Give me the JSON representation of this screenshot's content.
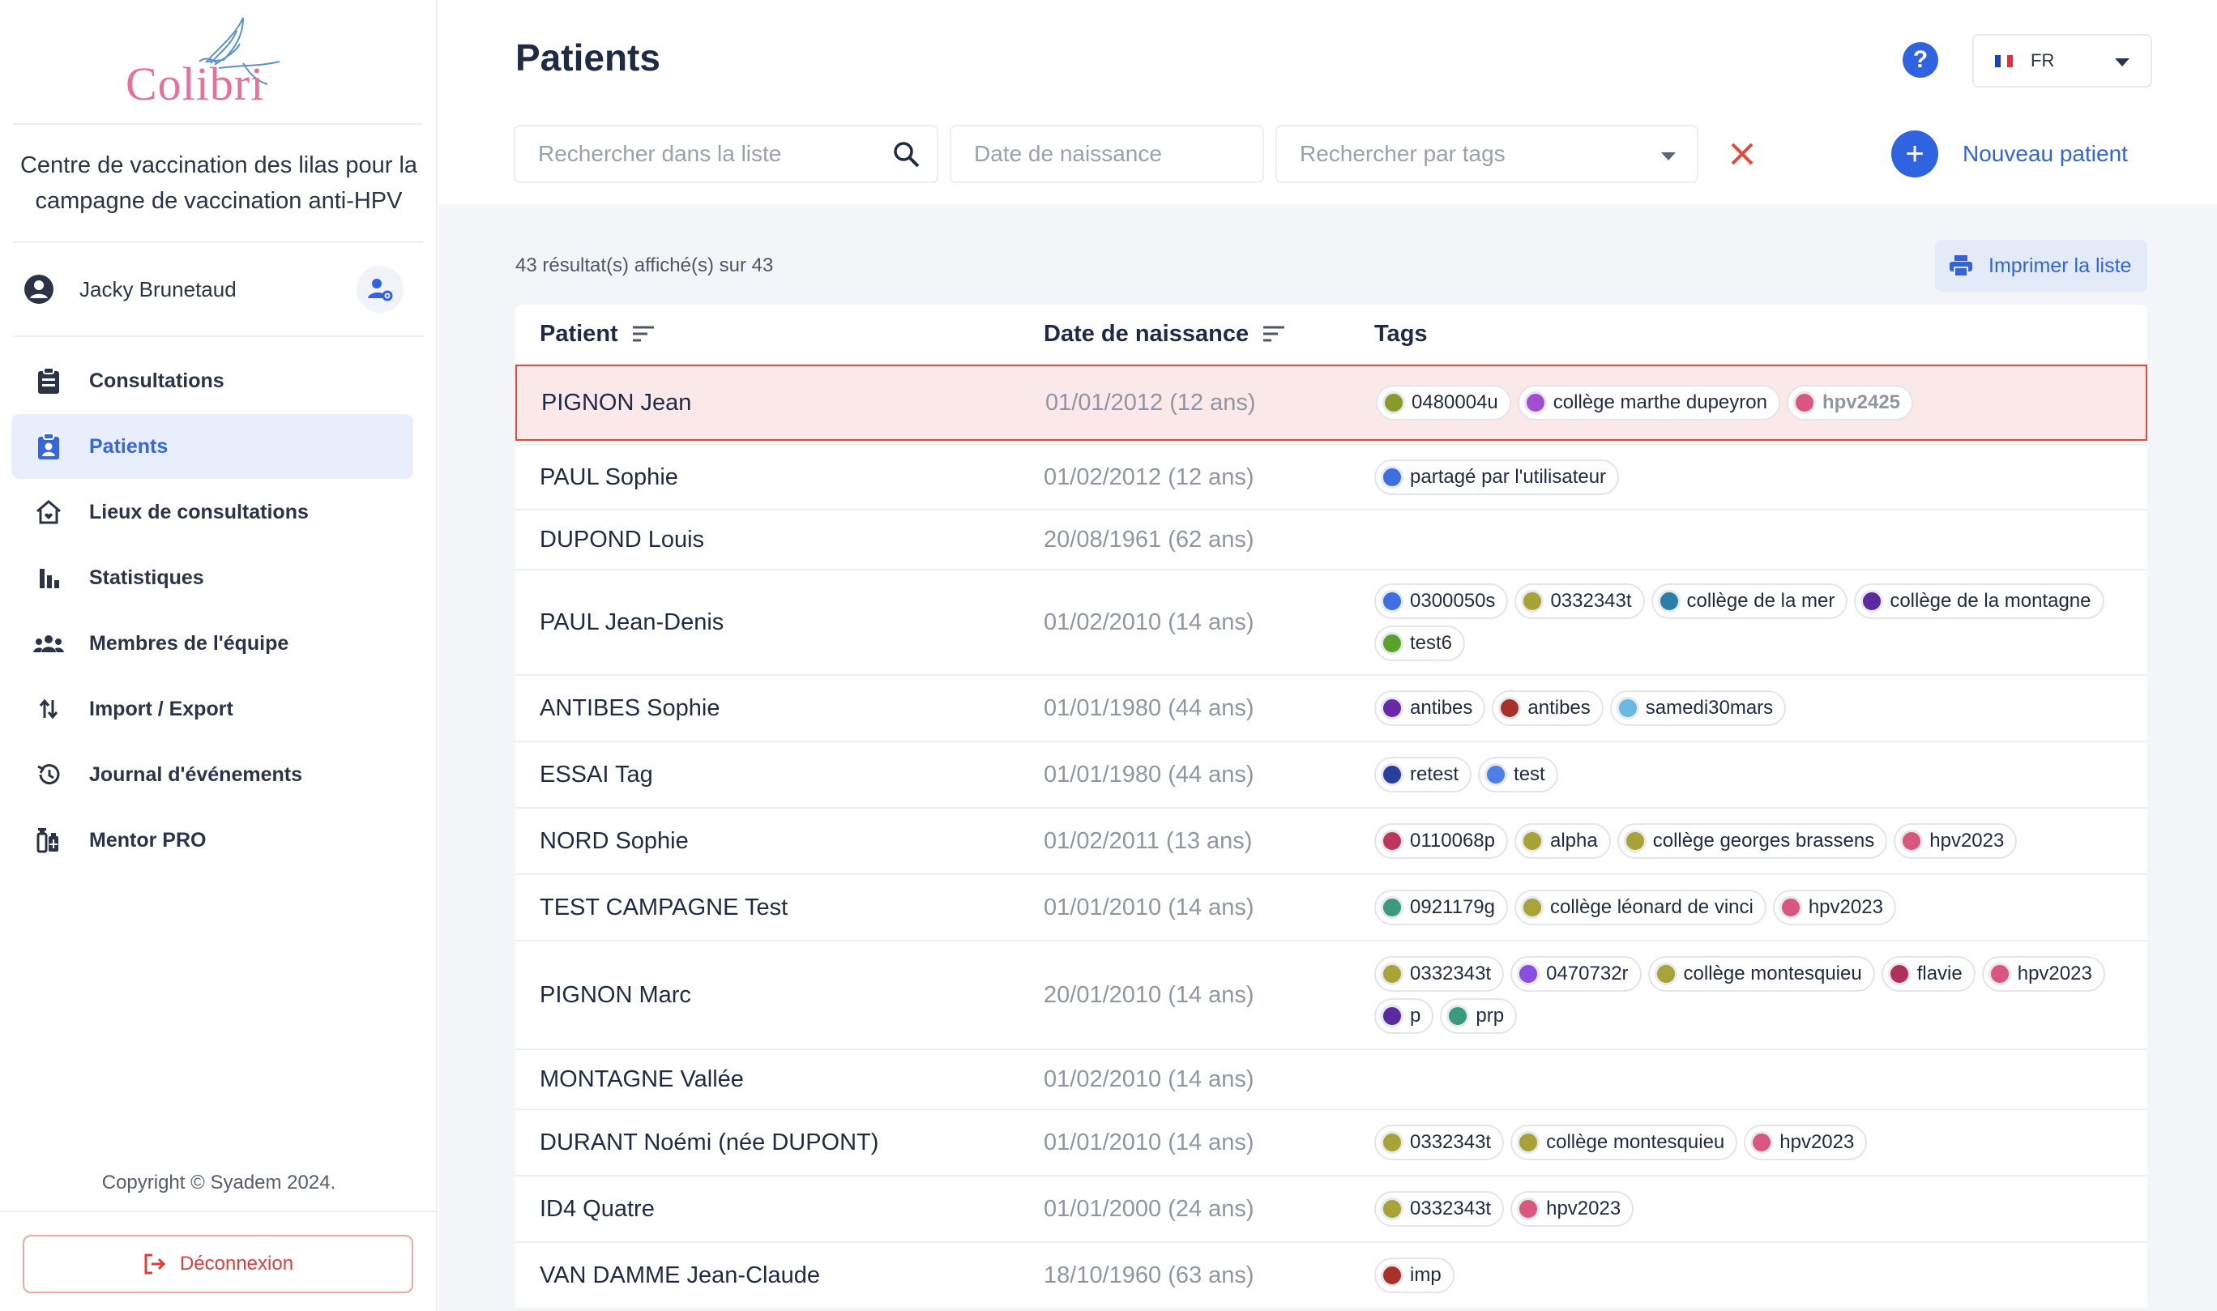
{
  "logo": {
    "text": "Colibri"
  },
  "center_name": "Centre de vaccination des lilas pour la campagne de vaccination anti-HPV",
  "user": {
    "name": "Jacky Brunetaud"
  },
  "nav": [
    {
      "label": "Consultations",
      "icon": "clipboard-icon",
      "active": false
    },
    {
      "label": "Patients",
      "icon": "patient-badge-icon",
      "active": true
    },
    {
      "label": "Lieux de consultations",
      "icon": "home-icon",
      "active": false
    },
    {
      "label": "Statistiques",
      "icon": "bar-chart-icon",
      "active": false
    },
    {
      "label": "Membres de l'équipe",
      "icon": "team-icon",
      "active": false
    },
    {
      "label": "Import / Export",
      "icon": "import-export-icon",
      "active": false
    },
    {
      "label": "Journal d'événements",
      "icon": "history-icon",
      "active": false
    },
    {
      "label": "Mentor PRO",
      "icon": "vaccine-icon",
      "active": false
    }
  ],
  "copyright": "Copyright © Syadem 2024.",
  "logout_label": "Déconnexion",
  "page_title": "Patients",
  "language": {
    "code": "FR",
    "flag_colors": [
      "#1f3fb5",
      "#ffffff",
      "#e3313c"
    ]
  },
  "filters": {
    "search_placeholder": "Rechercher dans la liste",
    "date_placeholder": "Date de naissance",
    "tags_placeholder": "Rechercher par tags"
  },
  "new_patient_label": "Nouveau patient",
  "results_text": "43 résultat(s) affiché(s) sur 43",
  "print_label": "Imprimer la liste",
  "columns": {
    "patient": "Patient",
    "birthdate": "Date de naissance",
    "tags": "Tags"
  },
  "rows": [
    {
      "name": "PIGNON Jean",
      "birth": "01/01/2012 (12 ans)",
      "highlight": true,
      "height": 94,
      "tags": [
        {
          "label": "0480004u",
          "color": "#8a9a2a"
        },
        {
          "label": "collège marthe dupeyron",
          "color": "#a04fd0"
        },
        {
          "label": "hpv2425",
          "color": "#d9577e",
          "muted": true
        }
      ]
    },
    {
      "name": "PAUL Sophie",
      "birth": "01/02/2012 (12 ans)",
      "height": 80,
      "tags": [
        {
          "label": "partagé par l'utilisateur",
          "color": "#3f6ee0"
        }
      ]
    },
    {
      "name": "DUPOND Louis",
      "birth": "20/08/1961 (62 ans)",
      "height": 74,
      "tags": []
    },
    {
      "name": "PAUL Jean-Denis",
      "birth": "01/02/2010 (14 ans)",
      "height": 130,
      "tags": [
        {
          "label": "0300050s",
          "color": "#3f6ee0"
        },
        {
          "label": "0332343t",
          "color": "#a7a336"
        },
        {
          "label": "collège de la mer",
          "color": "#2a7fa8"
        },
        {
          "label": "collège de la montagne",
          "color": "#5b2aa0"
        },
        {
          "label": "test6",
          "color": "#5aa32a"
        }
      ]
    },
    {
      "name": "ANTIBES Sophie",
      "birth": "01/01/1980 (44 ans)",
      "height": 82,
      "tags": [
        {
          "label": "antibes",
          "color": "#6a2aa8"
        },
        {
          "label": "antibes",
          "color": "#a8302a"
        },
        {
          "label": "samedi30mars",
          "color": "#6ab8e0"
        }
      ]
    },
    {
      "name": "ESSAI Tag",
      "birth": "01/01/1980 (44 ans)",
      "height": 82,
      "tags": [
        {
          "label": "retest",
          "color": "#2a3f9a"
        },
        {
          "label": "test",
          "color": "#4f7ee6"
        }
      ]
    },
    {
      "name": "NORD Sophie",
      "birth": "01/02/2011 (13 ans)",
      "height": 82,
      "tags": [
        {
          "label": "0110068p",
          "color": "#c0355c"
        },
        {
          "label": "alpha",
          "color": "#a7a336"
        },
        {
          "label": "collège georges brassens",
          "color": "#a7a336"
        },
        {
          "label": "hpv2023",
          "color": "#d9577e"
        }
      ]
    },
    {
      "name": "TEST CAMPAGNE Test",
      "birth": "01/01/2010 (14 ans)",
      "height": 82,
      "tags": [
        {
          "label": "0921179g",
          "color": "#3a9a7e"
        },
        {
          "label": "collège léonard de vinci",
          "color": "#a7a336"
        },
        {
          "label": "hpv2023",
          "color": "#d9577e"
        }
      ]
    },
    {
      "name": "PIGNON Marc",
      "birth": "20/01/2010 (14 ans)",
      "height": 134,
      "tags": [
        {
          "label": "0332343t",
          "color": "#a7a336"
        },
        {
          "label": "0470732r",
          "color": "#8a4fe0"
        },
        {
          "label": "collège montesquieu",
          "color": "#a7a336"
        },
        {
          "label": "flavie",
          "color": "#b0305c"
        },
        {
          "label": "hpv2023",
          "color": "#d9577e"
        },
        {
          "label": "p",
          "color": "#5a2aa0"
        },
        {
          "label": "prp",
          "color": "#3a9a7e"
        }
      ]
    },
    {
      "name": "MONTAGNE Vallée",
      "birth": "01/02/2010 (14 ans)",
      "height": 74,
      "tags": []
    },
    {
      "name": "DURANT Noémi (née DUPONT)",
      "birth": "01/01/2010 (14 ans)",
      "height": 82,
      "tags": [
        {
          "label": "0332343t",
          "color": "#a7a336"
        },
        {
          "label": "collège montesquieu",
          "color": "#a7a336"
        },
        {
          "label": "hpv2023",
          "color": "#d9577e"
        }
      ]
    },
    {
      "name": "ID4 Quatre",
      "birth": "01/01/2000 (24 ans)",
      "height": 82,
      "tags": [
        {
          "label": "0332343t",
          "color": "#a7a336"
        },
        {
          "label": "hpv2023",
          "color": "#d9577e"
        }
      ]
    },
    {
      "name": "VAN DAMME Jean-Claude",
      "birth": "18/10/1960 (63 ans)",
      "height": 82,
      "tags": [
        {
          "label": "imp",
          "color": "#a8302a"
        }
      ]
    }
  ]
}
